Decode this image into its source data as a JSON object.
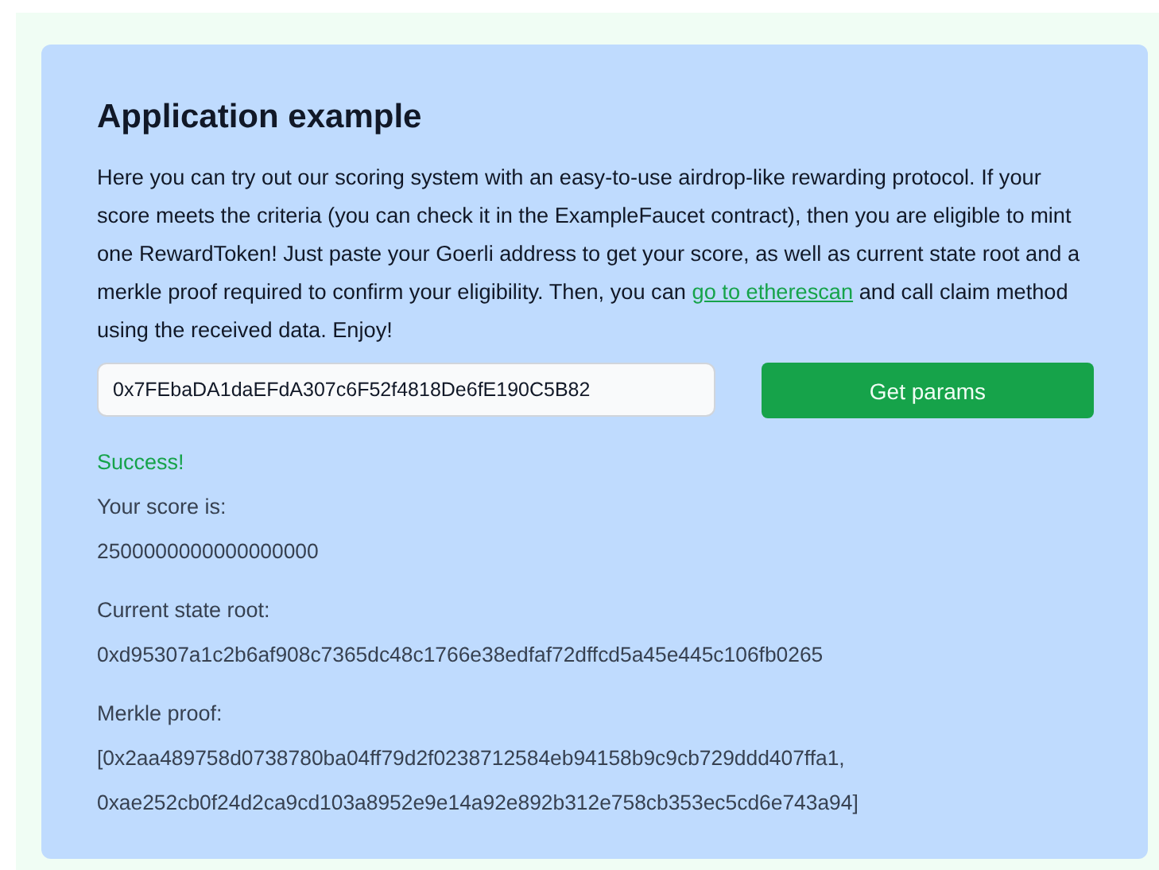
{
  "title": "Application example",
  "intro": {
    "text_before": "Here you can try out our scoring system with an easy-to-use airdrop-like rewarding protocol. If your score meets the criteria (you can check it in the ExampleFaucet contract), then you are eligible to mint one RewardToken! Just paste your Goerli address to get your score, as well as current state root and a merkle proof required to confirm your eligibility. Then, you can ",
    "link": "go to etherescan",
    "text_after": " and call claim method using the received data. Enjoy!"
  },
  "address_field": {
    "value": "0x7FEbaDA1daEFdA307c6F52f4818De6fE190C5B82"
  },
  "button": "Get params",
  "status": "Success!",
  "results": [
    {
      "label": "Your score is:",
      "value": "2500000000000000000"
    },
    {
      "label": "Current state root:",
      "value": "0xd95307a1c2b6af908c7365dc48c1766e38edfaf72dffcd5a45e445c106fb0265"
    },
    {
      "label": "Merkle proof:",
      "value": "[0x2aa489758d0738780ba04ff79d2f0238712584eb94158b9c9cb729ddd407ffa1, 0xae252cb0f24d2ca9cd103a8952e9e14a92e892b312e758cb353ec5cd6e743a94]"
    }
  ]
}
